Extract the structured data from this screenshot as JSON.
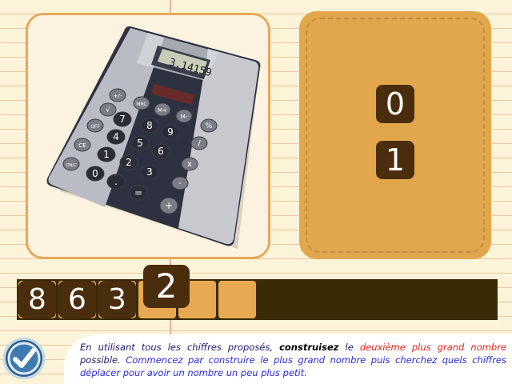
{
  "picture": {
    "subject": "calculator",
    "display": "3.14159",
    "keys": {
      "row1": [
        "+/-",
        "MRC",
        "M+",
        "M-"
      ],
      "row2": [
        "√",
        "%"
      ],
      "row3": [
        "OFF",
        "7",
        "8",
        "9",
        "/"
      ],
      "row4": [
        "CE",
        "4",
        "5",
        "6",
        "x"
      ],
      "row5": [
        "ON/C",
        "1",
        "2",
        "3",
        "-"
      ],
      "row6": [
        "0",
        ".",
        "=",
        "+"
      ]
    }
  },
  "digit_tray": {
    "tiles": [
      "0",
      "1"
    ]
  },
  "answer": {
    "placed": [
      "8",
      "6",
      "3"
    ],
    "dragging": "2",
    "empty_slots": 2
  },
  "check_button": {
    "icon": "checkmark-icon"
  },
  "instruction": {
    "part1": "En utilisant tous les chiffres proposés, ",
    "bold": "construisez",
    "part2": " le ",
    "red": "deuxième plus grand nombre",
    "part3": " possible. ",
    "blue": "Commencez par construire le plus grand nombre puis cherchez quels chiffres déplacer pour avoir un nombre un peu plus petit."
  },
  "colors": {
    "tile": "#4a2d0d",
    "tray": "#e2a74d",
    "answer_bar": "#3a2a06",
    "slot": "#e8a851",
    "highlight_red": "#e0261c",
    "hint_blue": "#2a2ad8"
  }
}
